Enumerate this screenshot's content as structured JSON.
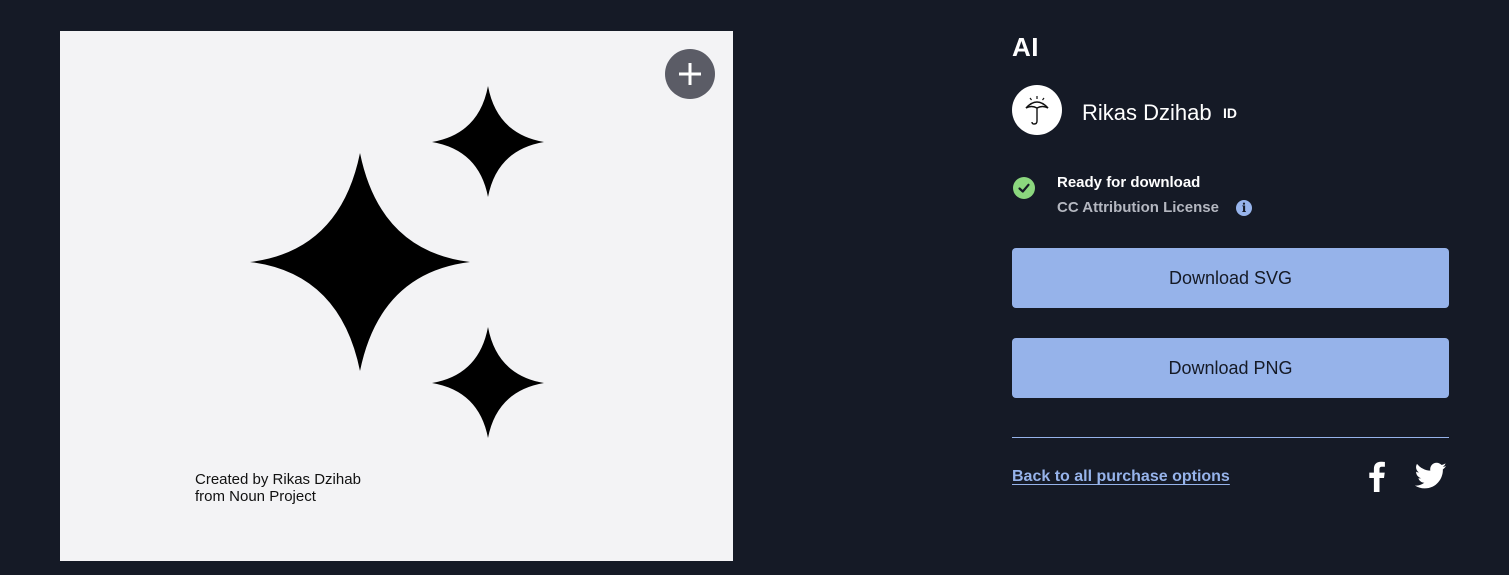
{
  "preview": {
    "add_icon": "plus-icon",
    "image_icon": "sparkles-icon",
    "credit_line1": "Created by Rikas Dzihab",
    "credit_line2": "from Noun Project"
  },
  "icon_details": {
    "title": "AI",
    "author_name": "Rikas Dzihab",
    "author_country": "ID",
    "avatar_icon": "umbrella-icon",
    "status": "Ready for download",
    "license": "CC Attribution License",
    "license_info_icon": "info-icon"
  },
  "actions": {
    "download_svg": "Download SVG",
    "download_png": "Download PNG",
    "back_link": "Back to all purchase options"
  },
  "share": {
    "facebook_icon": "facebook-icon",
    "twitter_icon": "twitter-icon"
  },
  "colors": {
    "background": "#151a26",
    "preview_bg": "#f3f3f5",
    "accent": "#96b3ea",
    "success": "#8bd77e"
  }
}
